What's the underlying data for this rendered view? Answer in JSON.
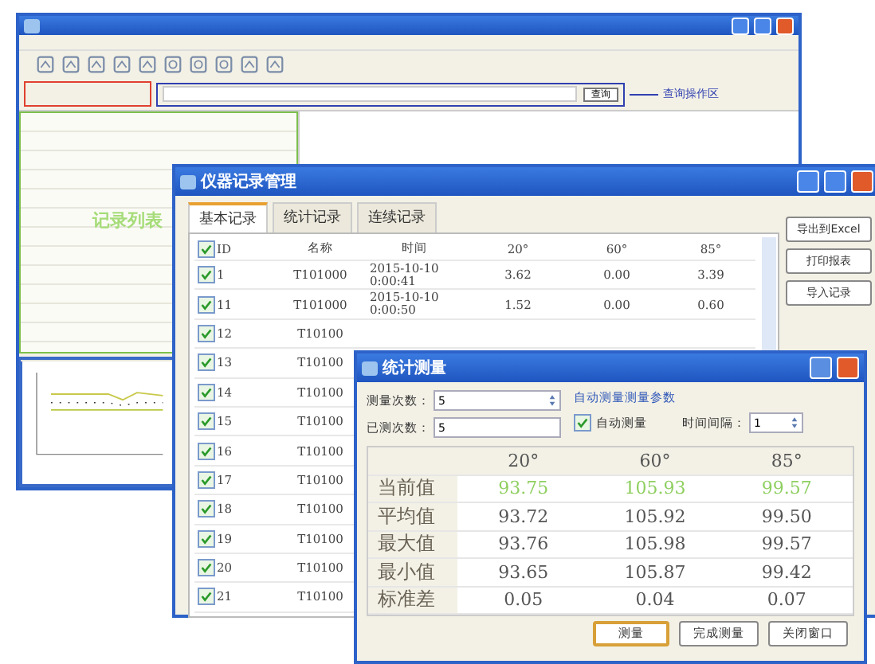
{
  "main_window": {
    "search": {
      "button": "查询"
    },
    "annotation": "查询操作区",
    "list_overlay_label": "记录列表"
  },
  "record_window": {
    "title": "仪器记录管理",
    "tabs": [
      {
        "label": "基本记录",
        "selected": true
      },
      {
        "label": "统计记录",
        "selected": false
      },
      {
        "label": "连续记录",
        "selected": false
      }
    ],
    "side_buttons": [
      "导出到Excel",
      "打印报表",
      "导入记录"
    ],
    "all_checked": true,
    "columns": [
      "ID",
      "名称",
      "时间",
      "20°",
      "60°",
      "85°"
    ],
    "rows": [
      {
        "checked": true,
        "id": "1",
        "name": "T101000",
        "time": "2015-10-10 0:00:41",
        "v20": "3.62",
        "v60": "0.00",
        "v85": "3.39"
      },
      {
        "checked": true,
        "id": "11",
        "name": "T101000",
        "time": "2015-10-10 0:00:50",
        "v20": "1.52",
        "v60": "0.00",
        "v85": "0.60"
      },
      {
        "checked": true,
        "id": "12",
        "name": "T10100"
      },
      {
        "checked": true,
        "id": "13",
        "name": "T10100"
      },
      {
        "checked": true,
        "id": "14",
        "name": "T10100"
      },
      {
        "checked": true,
        "id": "15",
        "name": "T10100"
      },
      {
        "checked": true,
        "id": "16",
        "name": "T10100"
      },
      {
        "checked": true,
        "id": "17",
        "name": "T10100"
      },
      {
        "checked": true,
        "id": "18",
        "name": "T10100"
      },
      {
        "checked": true,
        "id": "19",
        "name": "T10100"
      },
      {
        "checked": true,
        "id": "20",
        "name": "T10100"
      },
      {
        "checked": true,
        "id": "21",
        "name": "T10100"
      }
    ]
  },
  "stats_dialog": {
    "title": "统计测量",
    "count_label": "测量次数：",
    "count_value": "5",
    "done_label": "已测次数：",
    "done_value": "5",
    "auto_link": "自动测量测量参数",
    "auto_checkbox": {
      "label": "自动测量",
      "checked": true
    },
    "interval_label": "时间间隔：",
    "interval_value": "1",
    "columns": [
      "20°",
      "60°",
      "85°"
    ],
    "rows": [
      {
        "kind": "current",
        "label": "当前值",
        "values": [
          "93.75",
          "105.93",
          "99.57"
        ]
      },
      {
        "kind": "stat",
        "label": "平均值",
        "values": [
          "93.72",
          "105.92",
          "99.50"
        ]
      },
      {
        "kind": "stat",
        "label": "最大值",
        "values": [
          "93.76",
          "105.98",
          "99.57"
        ]
      },
      {
        "kind": "stat",
        "label": "最小值",
        "values": [
          "93.65",
          "105.87",
          "99.42"
        ]
      },
      {
        "kind": "stat",
        "label": "标准差",
        "values": [
          "0.05",
          "0.04",
          "0.07"
        ]
      }
    ],
    "buttons": [
      {
        "label": "测量",
        "default": true
      },
      {
        "label": "完成测量",
        "default": false
      },
      {
        "label": "关闭窗口",
        "default": false
      }
    ]
  }
}
